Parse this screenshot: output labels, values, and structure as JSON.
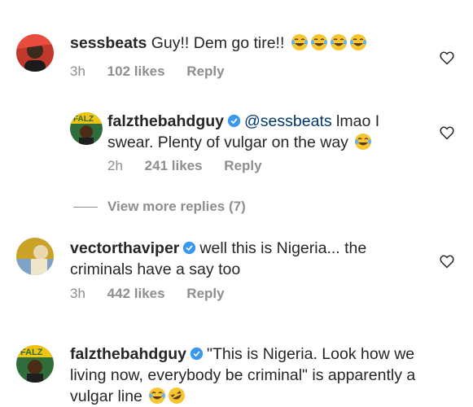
{
  "comments": [
    {
      "username": "sessbeats",
      "text": "Guy!! Dem go tire!!",
      "time": "3h",
      "likes": "102 likes",
      "reply": "Reply"
    },
    {
      "username": "falzthebahdguy",
      "mention": "@sessbeats",
      "text": "lmao I swear. Plenty of vulgar on the way",
      "time": "2h",
      "likes": "241 likes",
      "reply": "Reply"
    },
    {
      "username": "vectorthaviper",
      "text": "well this is Nigeria... the criminals have a say too",
      "time": "3h",
      "likes": "442 likes",
      "reply": "Reply"
    },
    {
      "username": "falzthebahdguy",
      "text": "\"This is Nigeria. Look how we living now, everybody be criminal\" is apparently a vulgar line"
    }
  ],
  "view_more": "View more replies (7)",
  "colors": {
    "text": "#262626",
    "meta": "#8e8e8e",
    "mention": "#00376b",
    "verified": "#3897f0"
  },
  "icons": [
    "heart-icon",
    "verified-badge-icon",
    "laughing-tears-emoji",
    "rolling-laughing-emoji"
  ]
}
